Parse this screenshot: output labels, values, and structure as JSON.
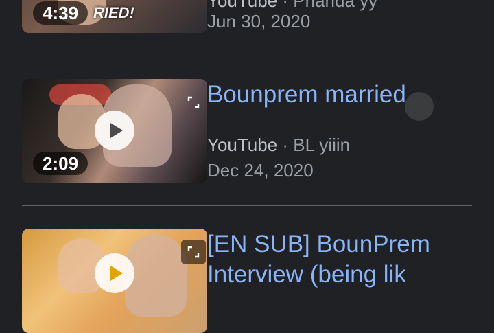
{
  "results": [
    {
      "duration": "4:39",
      "thumb_text": "RIED!",
      "source": "YouTube",
      "separator": " · ",
      "channel": "Phanda yy",
      "date": "Jun 30, 2020"
    },
    {
      "title": "Bounprem married",
      "duration": "2:09",
      "source": "YouTube",
      "separator": " · ",
      "channel": "BL yiiin",
      "date": "Dec 24, 2020"
    },
    {
      "title": "[EN SUB] BounPrem",
      "title_line2": "Interview (being lik"
    }
  ],
  "colors": {
    "background": "#202124",
    "link": "#8ab4f8",
    "meta": "#9aa0a6",
    "divider": "#5f6368"
  }
}
